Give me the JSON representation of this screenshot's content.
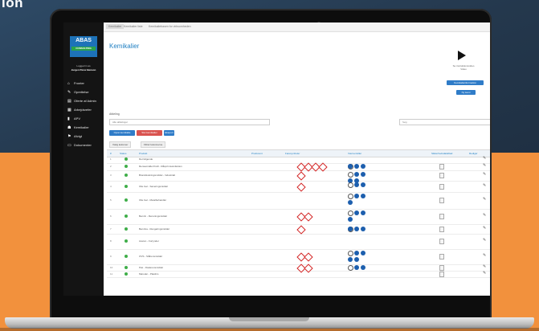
{
  "background": {
    "top_text": "ion",
    "orange": "#f2913d",
    "navy": "#24384d"
  },
  "app": {
    "logo_main": "ABAS",
    "logo_sub": "CONSULTING",
    "user_line1": "Logged in as",
    "user_line2": "Jurgen Perez Benson",
    "nav": [
      {
        "icon": "home-icon",
        "glyph": "⌂",
        "label": "Fronter"
      },
      {
        "icon": "wrench-icon",
        "glyph": "✎",
        "label": "Oprettelse"
      },
      {
        "icon": "folder-icon",
        "glyph": "▤",
        "label": "Oferte af Admin"
      },
      {
        "icon": "grid-icon",
        "glyph": "▦",
        "label": "Arbejdsrefer"
      },
      {
        "icon": "doc-icon",
        "glyph": "▮",
        "label": "APV"
      },
      {
        "icon": "users-icon",
        "glyph": "☗",
        "label": "Kemikalier"
      },
      {
        "icon": "flag-icon",
        "glyph": "⚑",
        "label": "Afvigt"
      },
      {
        "icon": "book-icon",
        "glyph": "▭",
        "label": "Dokumenter"
      }
    ],
    "breadcrumbs": [
      "Kemikalier",
      "Kemikalier liste",
      "Kemikaliebasen for virksomheden"
    ],
    "page_title": "Kemikalier",
    "widget": {
      "line1": "Se instruktionsvideo",
      "line2": "Video",
      "btn1": "Kemikalieinformation",
      "btn2": "Ny kemi"
    },
    "filter": {
      "label": "Afdeling",
      "select_value": "Alle afdelinger",
      "search_placeholder": "Søg"
    },
    "actions": [
      {
        "label": "Opret kemikalie",
        "color": "#2f7cc8"
      },
      {
        "label": "Slet kemikalier",
        "color": "#d9534f"
      },
      {
        "label": "Eksport",
        "color": "#2f7cc8"
      }
    ],
    "tools": [
      "Vælg kolonner",
      "Filtrér kolonnerne"
    ],
    "columns": [
      "#",
      "Status",
      "Produkt",
      "Producent",
      "Faresymboler",
      "Værnemidler",
      "Sikkerhedsdatablad",
      "Redigér"
    ],
    "rows": [
      {
        "num": "1",
        "name": "Det følgende"
      },
      {
        "num": "2",
        "name": "Rensemiddel Kraft - Råsprit desinfektion"
      },
      {
        "num": "3",
        "name": "Brandslukningsmiddel - Industrialt"
      },
      {
        "num": "4",
        "name": "Olie Gel - Saneringsmiddel"
      },
      {
        "num": "5",
        "name": "Olie Gel - Metalbehandler"
      },
      {
        "num": "6",
        "name": "Benzin - Rensningsmiddel"
      },
      {
        "num": "7",
        "name": "Benzina - Rengøringsmiddel"
      },
      {
        "num": "8",
        "name": "Aceton - Fortynder"
      },
      {
        "num": "9",
        "name": "OVS - Stålrensmiddel"
      },
      {
        "num": "10",
        "name": "Pek - Fladerensmiddel"
      },
      {
        "num": "11",
        "name": "Maruder - Plastlim"
      }
    ]
  }
}
